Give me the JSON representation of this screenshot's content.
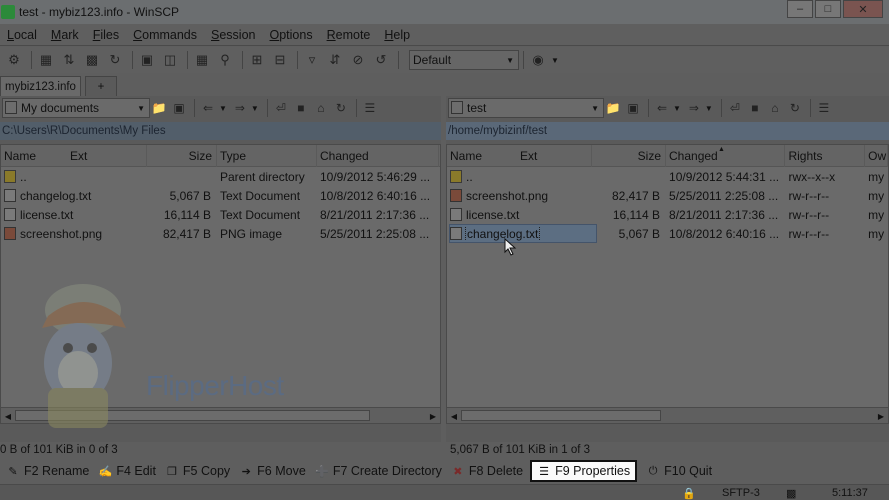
{
  "window": {
    "title": "test - mybiz123.info - WinSCP"
  },
  "menu": [
    {
      "label": "Local",
      "u": "L",
      "rest": "ocal"
    },
    {
      "label": "Mark",
      "u": "M",
      "rest": "ark"
    },
    {
      "label": "Files",
      "u": "F",
      "rest": "iles"
    },
    {
      "label": "Commands",
      "u": "C",
      "rest": "ommands"
    },
    {
      "label": "Session",
      "u": "S",
      "rest": "ession"
    },
    {
      "label": "Options",
      "u": "O",
      "rest": "ptions"
    },
    {
      "label": "Remote",
      "u": "R",
      "rest": "emote"
    },
    {
      "label": "Help",
      "u": "H",
      "rest": "elp"
    }
  ],
  "toolbar": {
    "transfer_preset": "Default"
  },
  "tabs": {
    "session": "mybiz123.info",
    "new": "+"
  },
  "left": {
    "location": "My documents",
    "path": "C:\\Users\\R\\Documents\\My Files",
    "columns": {
      "name": "Name",
      "ext": "Ext",
      "size": "Size",
      "type": "Type",
      "changed": "Changed"
    },
    "rows": [
      {
        "name": "..",
        "size": "",
        "type": "Parent directory",
        "changed": "10/9/2012  5:46:29 ...",
        "icon": "up"
      },
      {
        "name": "changelog.txt",
        "size": "5,067 B",
        "type": "Text Document",
        "changed": "10/8/2012  6:40:16 ...",
        "icon": "txt"
      },
      {
        "name": "license.txt",
        "size": "16,114 B",
        "type": "Text Document",
        "changed": "8/21/2011  2:17:36 ...",
        "icon": "txt"
      },
      {
        "name": "screenshot.png",
        "size": "82,417 B",
        "type": "PNG image",
        "changed": "5/25/2011  2:25:08 ...",
        "icon": "img"
      }
    ],
    "status": "0 B of 101 KiB in 0 of 3"
  },
  "right": {
    "location": "test",
    "path": "/home/mybizinf/test",
    "columns": {
      "name": "Name",
      "ext": "Ext",
      "size": "Size",
      "changed": "Changed",
      "rights": "Rights",
      "owner": "Ow"
    },
    "rows": [
      {
        "name": "..",
        "size": "",
        "changed": "10/9/2012  5:44:31 ...",
        "rights": "rwx--x--x",
        "owner": "my",
        "icon": "up"
      },
      {
        "name": "screenshot.png",
        "size": "82,417 B",
        "changed": "5/25/2011  2:25:08 ...",
        "rights": "rw-r--r--",
        "owner": "my",
        "icon": "img"
      },
      {
        "name": "license.txt",
        "size": "16,114 B",
        "changed": "8/21/2011  2:17:36 ...",
        "rights": "rw-r--r--",
        "owner": "my",
        "icon": "txt"
      },
      {
        "name": "changelog.txt",
        "size": "5,067 B",
        "changed": "10/8/2012  6:40:16 ...",
        "rights": "rw-r--r--",
        "owner": "my",
        "icon": "txt"
      }
    ],
    "status": "5,067 B of 101 KiB in 1 of 3"
  },
  "fkeys": [
    {
      "label": "F2 Rename",
      "icon": "rename-icon"
    },
    {
      "label": "F4 Edit",
      "icon": "edit-icon"
    },
    {
      "label": "F5 Copy",
      "icon": "copy-icon"
    },
    {
      "label": "F6 Move",
      "icon": "move-icon"
    },
    {
      "label": "F7 Create Directory",
      "icon": "folder-new-icon"
    },
    {
      "label": "F8 Delete",
      "icon": "delete-icon"
    },
    {
      "label": "F9 Properties",
      "icon": "properties-icon"
    },
    {
      "label": "F10 Quit",
      "icon": "quit-icon"
    }
  ],
  "statusbar": {
    "protocol": "SFTP-3",
    "time": "5:11:37"
  },
  "watermark": {
    "brand": "FlipperHost"
  }
}
